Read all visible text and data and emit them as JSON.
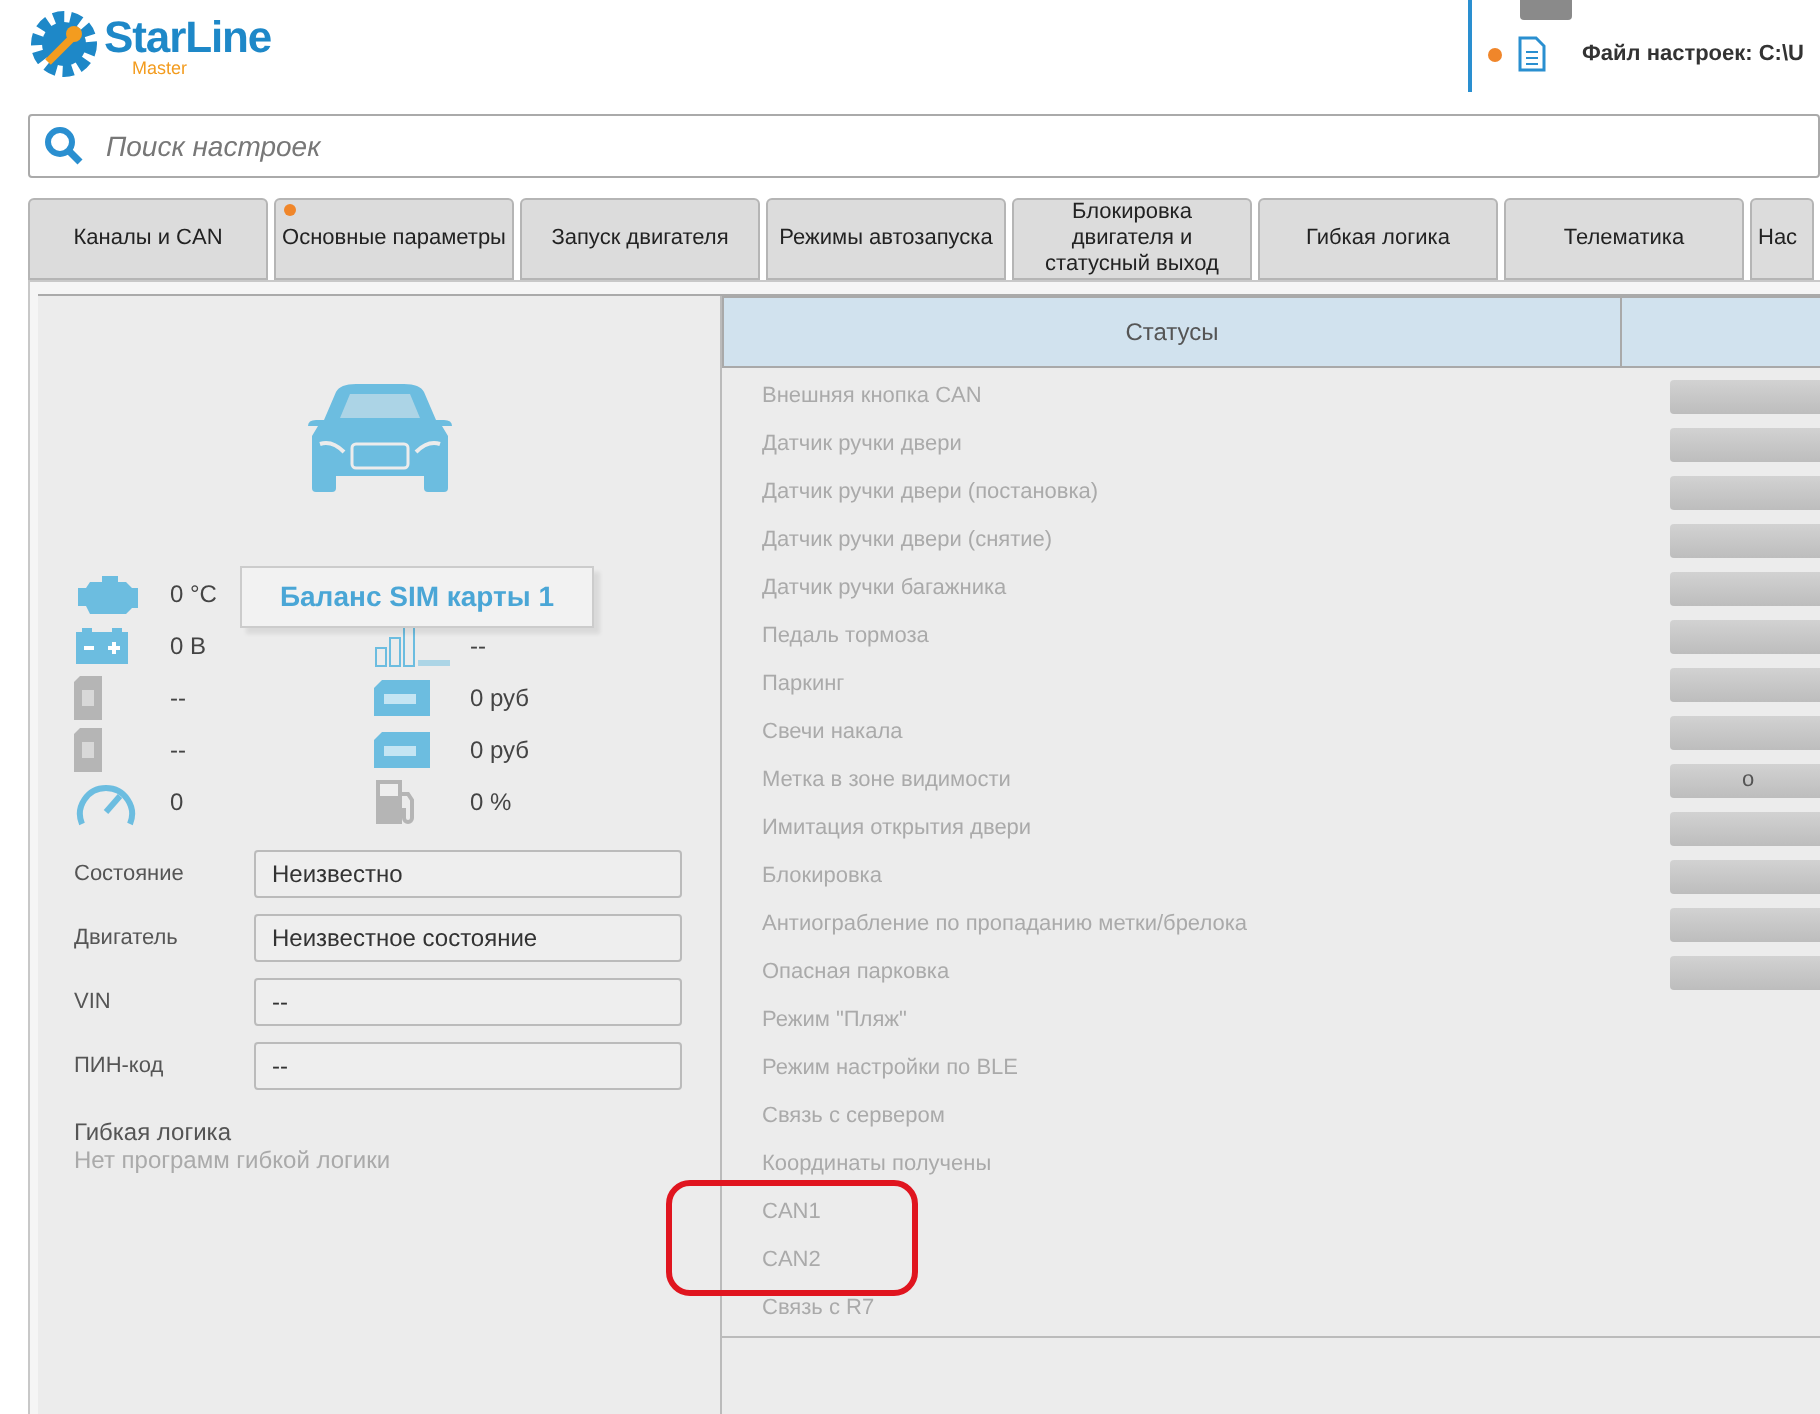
{
  "logo": {
    "name": "StarLine",
    "sub": "Master"
  },
  "file_panel": {
    "label": "Файл настроек: C:\\U",
    "modified": true
  },
  "search": {
    "placeholder": "Поиск настроек"
  },
  "tabs": [
    {
      "label": "Каналы и CAN",
      "modified": false
    },
    {
      "label": "Основные параметры",
      "modified": true
    },
    {
      "label": "Запуск двигателя",
      "modified": false
    },
    {
      "label": "Режимы автозапуска",
      "modified": false
    },
    {
      "label": "Блокировка двигателя и статусный выход",
      "modified": false
    },
    {
      "label": "Гибкая логика",
      "modified": false
    },
    {
      "label": "Телематика",
      "modified": false
    },
    {
      "label": "Нас",
      "modified": false
    }
  ],
  "tooltip": "Баланс SIM карты 1",
  "stats": [
    {
      "value": "0 °C"
    },
    {
      "value": "0 В"
    },
    {
      "value": "--"
    },
    {
      "value": "--"
    },
    {
      "value": "0 руб"
    },
    {
      "value": "--"
    },
    {
      "value": "0 руб"
    },
    {
      "value": "0"
    },
    {
      "value": "0 %"
    }
  ],
  "fields": [
    {
      "label": "Состояние",
      "value": "Неизвестно"
    },
    {
      "label": "Двигатель",
      "value": "Неизвестное состояние"
    },
    {
      "label": "VIN",
      "value": "--"
    },
    {
      "label": "ПИН-код",
      "value": "--"
    }
  ],
  "logic": {
    "title": "Гибкая логика",
    "text": "Нет программ гибкой логики"
  },
  "table": {
    "columns": [
      "Статусы"
    ],
    "rows": [
      {
        "label": "Внешняя кнопка CAN",
        "kind": "bar"
      },
      {
        "label": "Датчик ручки двери",
        "kind": "bar"
      },
      {
        "label": "Датчик ручки двери (постановка)",
        "kind": "bar"
      },
      {
        "label": "Датчик ручки двери (снятие)",
        "kind": "bar"
      },
      {
        "label": "Датчик ручки багажника",
        "kind": "bar"
      },
      {
        "label": "Педаль тормоза",
        "kind": "bar"
      },
      {
        "label": "Паркинг",
        "kind": "bar"
      },
      {
        "label": "Свечи накала",
        "kind": "bar"
      },
      {
        "label": "Метка в зоне видимости",
        "kind": "bar",
        "value": "о"
      },
      {
        "label": "Имитация открытия двери",
        "kind": "bar"
      },
      {
        "label": "Блокировка",
        "kind": "bar"
      },
      {
        "label": "Антиограбление по пропаданию метки/брелока",
        "kind": "bar"
      },
      {
        "label": "Опасная парковка",
        "kind": "bar"
      },
      {
        "label": "Режим \"Пляж\"",
        "kind": "plain"
      },
      {
        "label": "Режим настройки по BLE",
        "kind": "plain"
      },
      {
        "label": "Связь с сервером",
        "kind": "plain"
      },
      {
        "label": "Координаты получены",
        "kind": "plain"
      },
      {
        "label": "CAN1",
        "kind": "plain"
      },
      {
        "label": "CAN2",
        "kind": "plain"
      },
      {
        "label": "Связь с R7",
        "kind": "plain"
      }
    ]
  }
}
